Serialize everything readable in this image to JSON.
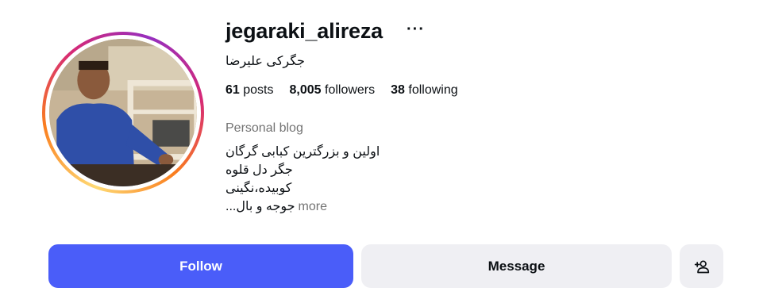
{
  "profile": {
    "username": "jegaraki_alireza",
    "more_options_label": "···",
    "full_name": "جگرکی علیرضا",
    "stats": {
      "posts_count": "61",
      "posts_label": "posts",
      "followers_count": "8,005",
      "followers_label": "followers",
      "following_count": "38",
      "following_label": "following"
    },
    "category": "Personal blog",
    "bio_lines": [
      "اولین و بزرگترین کبابی گرگان",
      "جگر دل قلوه",
      "کوبیده،نگینی",
      "جوجه و بال..."
    ],
    "bio_more_label": "more"
  },
  "actions": {
    "follow_label": "Follow",
    "message_label": "Message",
    "add_user_icon": "add-person-icon"
  },
  "colors": {
    "follow_bg": "#4a5df9",
    "secondary_bg": "#efeff3",
    "muted_text": "#737373"
  }
}
